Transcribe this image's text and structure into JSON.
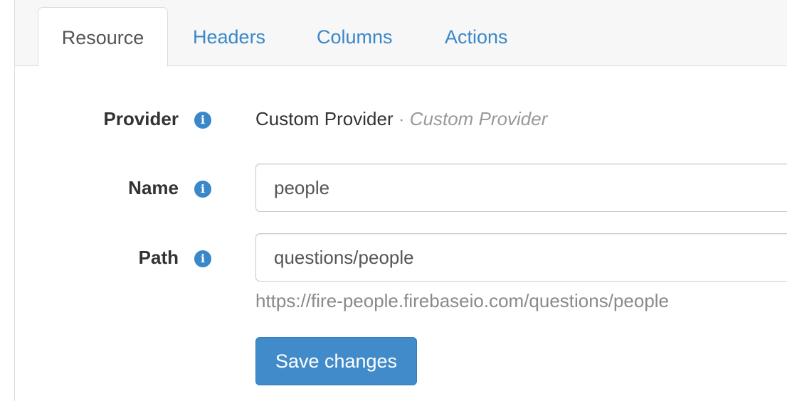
{
  "tabs": [
    {
      "label": "Resource",
      "active": true
    },
    {
      "label": "Headers",
      "active": false
    },
    {
      "label": "Columns",
      "active": false
    },
    {
      "label": "Actions",
      "active": false
    }
  ],
  "form": {
    "provider": {
      "label": "Provider",
      "value": "Custom Provider",
      "separator": "·",
      "secondary": "Custom Provider"
    },
    "name": {
      "label": "Name",
      "value": "people"
    },
    "path": {
      "label": "Path",
      "value": "questions/people",
      "help": "https://fire-people.firebaseio.com/questions/people"
    },
    "info_glyph": "i",
    "save_label": "Save changes"
  },
  "colors": {
    "accent": "#428bca",
    "link": "#3a87c9",
    "muted": "#999999"
  },
  "icons": {
    "info": "info-circle-icon"
  }
}
